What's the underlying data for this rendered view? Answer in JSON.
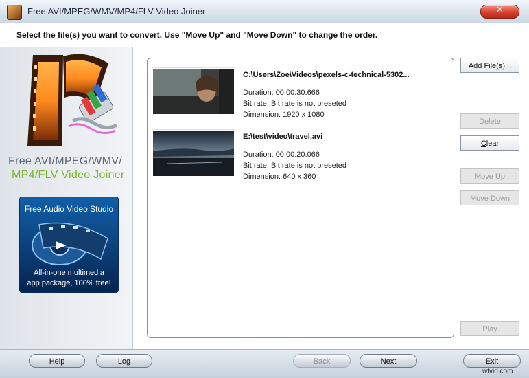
{
  "window": {
    "title": "Free AVI/MPEG/WMV/MP4/FLV Video Joiner",
    "close_symbol": "✕"
  },
  "instruction": "Select the file(s) you want to convert. Use \"Move Up\" and \"Move Down\" to change the order.",
  "left_panel": {
    "logo_line1": "Free AVI/MPEG/WMV/",
    "logo_line2": "MP4/FLV Video Joiner",
    "promo": {
      "title": "Free Audio Video Studio",
      "line1": "All-in-one multimedia",
      "line2": "app package, 100% free!"
    }
  },
  "files": [
    {
      "path": "C:\\Users\\Zoe\\Videos\\pexels-c-technical-5302...",
      "duration": "Duration: 00:00:30.666",
      "bitrate": "Bit rate: Bit rate is not preseted",
      "dimension": "Dimension: 1920 x 1080"
    },
    {
      "path": "E:\\test\\video\\travel.avi",
      "duration": "Duration: 00:00:20.066",
      "bitrate": "Bit rate: Bit rate is not preseted",
      "dimension": "Dimension: 640 x 360"
    }
  ],
  "side_buttons": {
    "add_prefix": "A",
    "add_rest": "dd File(s)...",
    "delete": "Delete",
    "clear_prefix": "C",
    "clear_rest": "lear",
    "move_up": "Move Up",
    "move_down": "Move Down",
    "play": "Play"
  },
  "bottom": {
    "help": "Help",
    "log": "Log",
    "back": "Back",
    "next": "Next",
    "exit": "Exit"
  },
  "watermark": "wtvid.com"
}
